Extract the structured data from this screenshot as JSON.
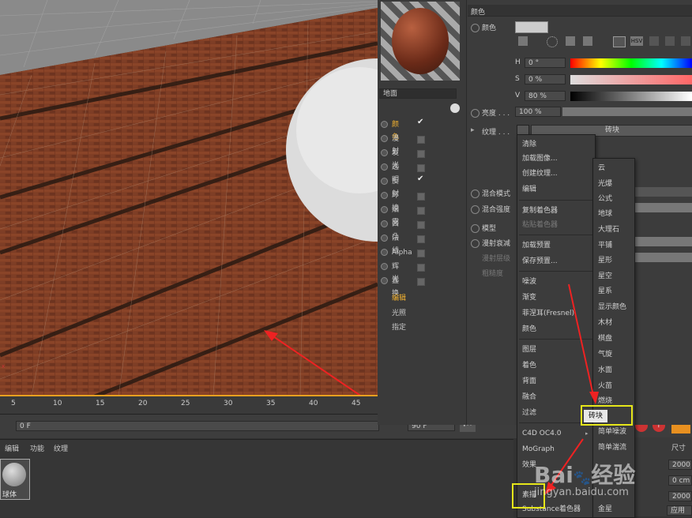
{
  "channels": {
    "items": [
      {
        "label": "颜色",
        "checked": true,
        "active": true
      },
      {
        "label": "漫射",
        "checked": false
      },
      {
        "label": "发光",
        "checked": false
      },
      {
        "label": "透明",
        "checked": false
      },
      {
        "label": "反射",
        "checked": true
      },
      {
        "label": "环境",
        "checked": false
      },
      {
        "label": "烟雾",
        "checked": false
      },
      {
        "label": "凹凸",
        "checked": false
      },
      {
        "label": "法线",
        "checked": false
      },
      {
        "label": "Alpha",
        "checked": false
      },
      {
        "label": "辉光",
        "checked": false
      },
      {
        "label": "置换",
        "checked": false
      }
    ],
    "links": [
      "编辑",
      "光照",
      "指定"
    ],
    "material_name": "地面"
  },
  "color_panel": {
    "section": "颜色",
    "color_label": "颜色",
    "h_label": "H",
    "h_value": "0 °",
    "s_label": "S",
    "s_value": "0 %",
    "v_label": "V",
    "v_value": "80 %",
    "brightness_label": "亮度 . . .",
    "brightness_value": "100 %",
    "texture_label": "纹理 . . .",
    "texture_value": "砖块",
    "blend_mode_label": "混合模式",
    "blend_strength_label": "混合强度",
    "model_label": "模型",
    "diffuse_falloff_label": "漫射衰减",
    "diffuse_level_label": "漫射层级",
    "roughness_label": "粗糙度",
    "hsv_button": "HSV"
  },
  "context_menu": {
    "items": [
      "清除",
      "加载图像...",
      "创建纹理...",
      "编辑",
      "复制着色器",
      "粘贴着色器",
      "加载预置",
      "保存预置...",
      "噪波",
      "渐变",
      "菲涅耳(Fresnel)",
      "颜色",
      "图层",
      "着色",
      "背面",
      "融合",
      "过滤",
      "C4D OC4.0",
      "MoGraph",
      "效果",
      "素描",
      "Substance着色器"
    ],
    "dim": [
      5
    ]
  },
  "submenu": {
    "items": [
      "云",
      "光爆",
      "公式",
      "地球",
      "大理石",
      "平铺",
      "星形",
      "星空",
      "星系",
      "显示颜色",
      "木材",
      "棋盘",
      "气旋",
      "水面",
      "火苗",
      "燃烧",
      "砖块",
      "简单噪波",
      "简单湍流",
      "金星"
    ],
    "selected": "砖块"
  },
  "timeline": {
    "ticks": [
      "5",
      "10",
      "15",
      "20",
      "25",
      "30",
      "35",
      "40",
      "45"
    ],
    "start_frame": "0 F",
    "end_frame": "90 F",
    "end_frame2": "90 F"
  },
  "material_manager": {
    "menu": [
      "编辑",
      "功能",
      "纹理"
    ],
    "material_label": "球体"
  },
  "coords": {
    "size_label": "尺寸",
    "x": "2000",
    "y": "0 cm",
    "z": "2000",
    "apply": "应用"
  },
  "watermark": "Bai 经验 jingyan.baidu.com"
}
